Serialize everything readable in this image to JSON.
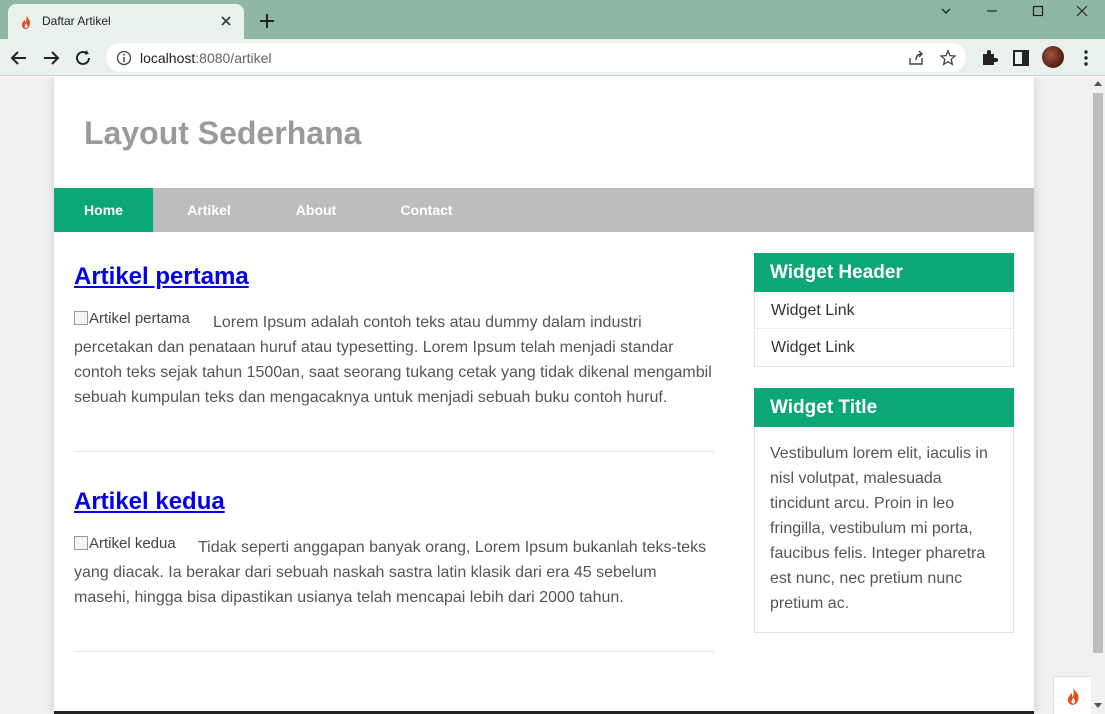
{
  "browser": {
    "tab_title": "Daftar Artikel",
    "url_host": "localhost",
    "url_rest": ":8080/artikel",
    "favicon": "flame-icon",
    "accent": "#8fb8a4"
  },
  "site": {
    "title": "Layout Sederhana",
    "nav": [
      {
        "label": "Home",
        "active": true
      },
      {
        "label": "Artikel",
        "active": false
      },
      {
        "label": "About",
        "active": false
      },
      {
        "label": "Contact",
        "active": false
      }
    ],
    "brand_color": "#0ba776"
  },
  "articles": [
    {
      "title": "Artikel pertama",
      "image_alt": "Artikel pertama",
      "text": "Lorem Ipsum adalah contoh teks atau dummy dalam industri percetakan dan penataan huruf atau typesetting. Lorem Ipsum telah menjadi standar contoh teks sejak tahun 1500an, saat seorang tukang cetak yang tidak dikenal mengambil sebuah kumpulan teks dan mengacaknya untuk menjadi sebuah buku contoh huruf."
    },
    {
      "title": "Artikel kedua",
      "image_alt": "Artikel kedua",
      "text": "Tidak seperti anggapan banyak orang, Lorem Ipsum bukanlah teks-teks yang diacak. Ia berakar dari sebuah naskah sastra latin klasik dari era 45 sebelum masehi, hingga bisa dipastikan usianya telah mencapai lebih dari 2000 tahun."
    }
  ],
  "widgets": [
    {
      "header": "Widget Header",
      "links": [
        "Widget Link",
        "Widget Link"
      ]
    },
    {
      "header": "Widget Title",
      "body": "Vestibulum lorem elit, iaculis in nisl volutpat, malesuada tincidunt arcu. Proin in leo fringilla, vestibulum mi porta, faucibus felis. Integer pharetra est nunc, nec pretium nunc pretium ac."
    }
  ]
}
